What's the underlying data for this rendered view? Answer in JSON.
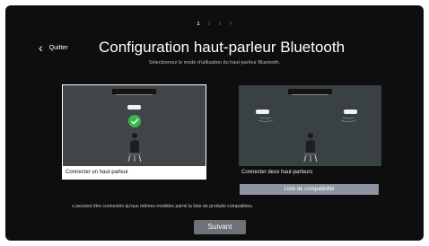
{
  "steps": [
    "1",
    "2",
    "3",
    "4"
  ],
  "active_step": 1,
  "header": {
    "back_label": "Quitter",
    "title": "Configuration haut-parleur Bluetooth",
    "subtitle": "Sélectionnez le mode d'utilisation du haut-parleur Bluetooth."
  },
  "options": [
    {
      "label": "Connecter un haut-parleur",
      "selected": true
    },
    {
      "label": "Connecter deux haut-parleurs",
      "selected": false
    }
  ],
  "compat_button": "Liste de compatibilité",
  "note": "s peuvent être connectés qu'aux mêmes modèles parmi la liste de produits compatibles.",
  "next_button": "Suivant",
  "colors": {
    "screen_bg": "#0e0e0e",
    "illustration_bg": "#3a4145",
    "check_green": "#3cb54a",
    "button_gray": "#6d7178",
    "compat_button": "#8d93a0"
  }
}
